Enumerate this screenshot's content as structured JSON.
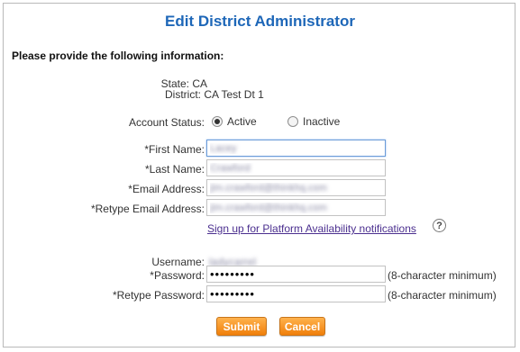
{
  "page": {
    "title": "Edit District Administrator",
    "intro": "Please provide the following information:"
  },
  "info": {
    "state_label": "State:",
    "state_value": "CA",
    "district_label": "District:",
    "district_value": "CA Test Dt 1"
  },
  "account_status": {
    "label": "Account Status:",
    "options": [
      "Active",
      "Inactive"
    ],
    "selected": "Active"
  },
  "fields": {
    "first_name": {
      "label": "*First Name:",
      "value": "Lacey"
    },
    "last_name": {
      "label": "*Last Name:",
      "value": "Crawford"
    },
    "email": {
      "label": "*Email Address:",
      "value": "jim.crawford@thinkhq.com"
    },
    "retype_email": {
      "label": "*Retype Email Address:",
      "value": "jim.crawford@thinkhq.com"
    }
  },
  "notifications_link": "Sign up for Platform Availability notifications",
  "help_icon": "question-circle-icon",
  "credentials": {
    "username_label": "Username:",
    "username_value": "ladycarrel",
    "password_label": "*Password:",
    "password_value": "•••••••••",
    "password_hint": "(8-character minimum)",
    "retype_password_label": "*Retype Password:",
    "retype_password_value": "•••••••••",
    "retype_password_hint": "(8-character minimum)"
  },
  "buttons": {
    "submit": "Submit",
    "cancel": "Cancel"
  },
  "colors": {
    "title": "#1e67b8",
    "button": "#f08a1c",
    "link": "#4b2f8f"
  }
}
